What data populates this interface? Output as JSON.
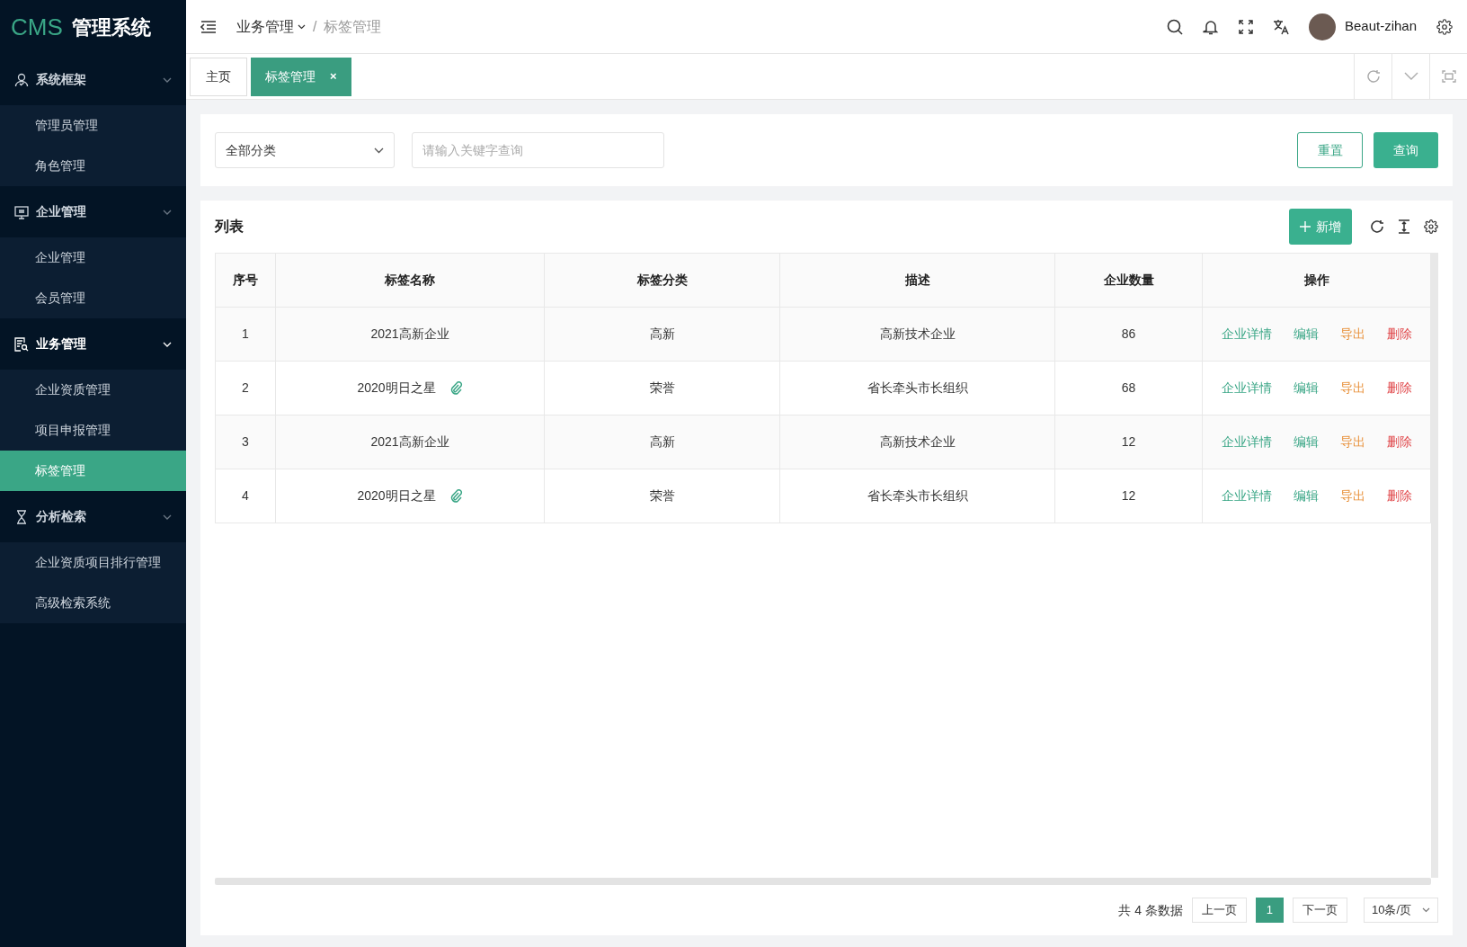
{
  "logo": {
    "brand": "CMS",
    "title": "管理系统"
  },
  "sidebar": {
    "groups": [
      {
        "label": "系统框架",
        "expanded": true,
        "children": [
          {
            "label": "管理员管理",
            "selected": false
          },
          {
            "label": "角色管理",
            "selected": false
          }
        ]
      },
      {
        "label": "企业管理",
        "expanded": true,
        "children": [
          {
            "label": "企业管理",
            "selected": false
          },
          {
            "label": "会员管理",
            "selected": false
          }
        ]
      },
      {
        "label": "业务管理",
        "expanded": true,
        "children": [
          {
            "label": "企业资质管理",
            "selected": false
          },
          {
            "label": "项目申报管理",
            "selected": false
          },
          {
            "label": "标签管理",
            "selected": true
          }
        ]
      },
      {
        "label": "分析检索",
        "expanded": true,
        "children": [
          {
            "label": "企业资质项目排行管理",
            "selected": false
          },
          {
            "label": "高级检索系统",
            "selected": false
          }
        ]
      }
    ]
  },
  "breadcrumb": [
    {
      "label": "业务管理",
      "has_menu": true
    },
    {
      "label": "标签管理",
      "has_menu": false
    }
  ],
  "breadcrumb_separator": "/",
  "user": {
    "name": "Beaut-zihan"
  },
  "tabs": [
    {
      "label": "主页",
      "selected": false,
      "closable": false
    },
    {
      "label": "标签管理",
      "selected": true,
      "closable": true
    }
  ],
  "tab_close": "×",
  "filters": {
    "category": "全部分类",
    "keyword_placeholder": "请输入关键字查询",
    "reset": "重置",
    "query": "查询"
  },
  "list": {
    "title": "列表",
    "add": "新增",
    "columns": [
      "序号",
      "标签名称",
      "标签分类",
      "描述",
      "企业数量",
      "操作"
    ],
    "rows": [
      {
        "index": "1",
        "name": "2021高新企业",
        "attachment": false,
        "category": "高新",
        "description": "高新技术企业",
        "count": "86",
        "actions": [
          {
            "label": "企业详情",
            "kind": "detail"
          },
          {
            "label": "编辑",
            "kind": "edit"
          },
          {
            "label": "导出",
            "kind": "export"
          },
          {
            "label": "删除",
            "kind": "delete"
          }
        ]
      },
      {
        "index": "2",
        "name": "2020明日之星",
        "attachment": true,
        "category": "荣誉",
        "description": "省长牵头市长组织",
        "count": "68",
        "actions": [
          {
            "label": "企业详情",
            "kind": "detail"
          },
          {
            "label": "编辑",
            "kind": "edit"
          },
          {
            "label": "导出",
            "kind": "export"
          },
          {
            "label": "删除",
            "kind": "delete"
          }
        ]
      },
      {
        "index": "3",
        "name": "2021高新企业",
        "attachment": false,
        "category": "高新",
        "description": "高新技术企业",
        "count": "12",
        "actions": [
          {
            "label": "企业详情",
            "kind": "detail"
          },
          {
            "label": "编辑",
            "kind": "edit"
          },
          {
            "label": "导出",
            "kind": "export"
          },
          {
            "label": "删除",
            "kind": "delete"
          }
        ]
      },
      {
        "index": "4",
        "name": "2020明日之星",
        "attachment": true,
        "category": "荣誉",
        "description": "省长牵头市长组织",
        "count": "12",
        "actions": [
          {
            "label": "企业详情",
            "kind": "detail"
          },
          {
            "label": "编辑",
            "kind": "edit"
          },
          {
            "label": "导出",
            "kind": "export"
          },
          {
            "label": "删除",
            "kind": "delete"
          }
        ]
      }
    ]
  },
  "pagination": {
    "total": "共 4 条数据",
    "prev": "上一页",
    "pages": [
      {
        "label": "1",
        "selected": true
      }
    ],
    "next": "下一页",
    "page_size": "10条/页"
  }
}
